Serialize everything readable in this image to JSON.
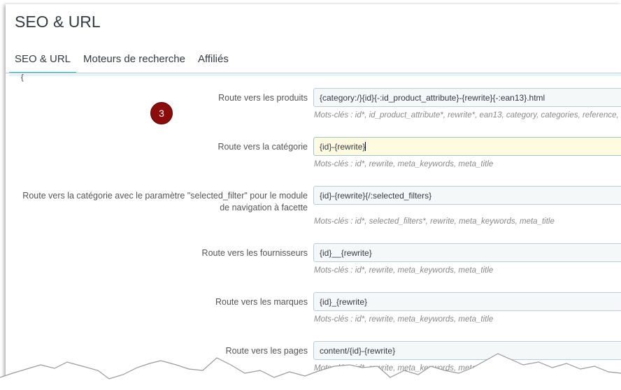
{
  "page": {
    "title": "SEO & URL"
  },
  "tabs": [
    {
      "label": "SEO & URL",
      "active": true
    },
    {
      "label": "Moteurs de recherche",
      "active": false
    },
    {
      "label": "Affiliés",
      "active": false
    }
  ],
  "badge": {
    "number": "3",
    "color": "#8c0b0b"
  },
  "routes": [
    {
      "label": "Route vers les produits",
      "value": "{category:/}{id}{-:id_product_attribute}-{rewrite}{-:ean13}.html",
      "help": "Mots-clés : id*, id_product_attribute*, rewrite*, ean13, category, categories, reference,"
    },
    {
      "label": "Route vers la catégorie",
      "value": "{id}-{rewrite}",
      "help": "Mots-clés : id*, rewrite, meta_keywords, meta_title"
    },
    {
      "label": "Route vers la catégorie avec le paramètre \"selected_filter\" pour le module de navigation à facette",
      "value": "{id}-{rewrite}{/:selected_filters}",
      "help": "Mots-clés : id*, selected_filters*, rewrite, meta_keywords, meta_title"
    },
    {
      "label": "Route vers les fournisseurs",
      "value": "{id}__{rewrite}",
      "help": "Mots-clés : id*, rewrite, meta_keywords, meta_title"
    },
    {
      "label": "Route vers les marques",
      "value": "{id}_{rewrite}",
      "help": "Mots-clés : id*, rewrite, meta_keywords, meta_title"
    },
    {
      "label": "Route vers les pages",
      "value": "content/{id}-{rewrite}",
      "help": "Mots-clés : id*, rewrite, meta_keywords, meta"
    }
  ],
  "colors": {
    "accent": "#25b9d7",
    "focus_bg": "#fffbe0"
  }
}
